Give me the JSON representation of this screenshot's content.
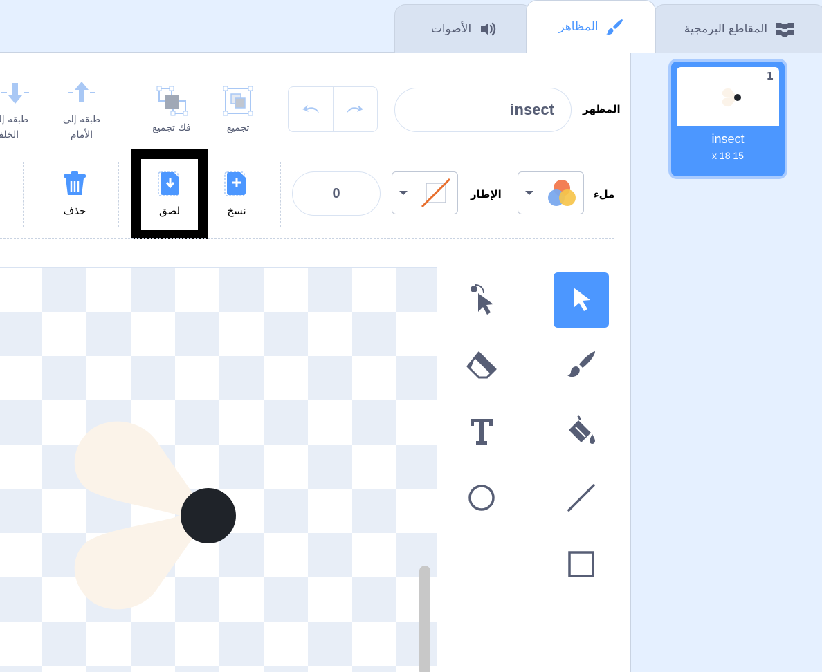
{
  "tabs": [
    {
      "label": "المقاطع البرمجية",
      "icon": "code-blocks-icon"
    },
    {
      "label": "المظاهر",
      "icon": "paint-brush-icon",
      "active": true
    },
    {
      "label": "الأصوات",
      "icon": "speaker-icon"
    }
  ],
  "toolbar": {
    "costume_label": "المظهر",
    "costume_name": "insect",
    "group_label": "تجميع",
    "ungroup_label": "فك تجميع",
    "forward_label_1": "طبقة إلى",
    "forward_label_2": "الأمام",
    "backward_label_1": "طبقة إلى",
    "backward_label_2": "الخلف",
    "fill_label": "ملء",
    "outline_label": "الإطار",
    "outline_width": "0",
    "copy_label": "نسخ",
    "paste_label": "لصق",
    "delete_label": "حذف"
  },
  "tools": [
    {
      "name": "select",
      "active": true
    },
    {
      "name": "reshape"
    },
    {
      "name": "brush"
    },
    {
      "name": "eraser"
    },
    {
      "name": "fill"
    },
    {
      "name": "text"
    },
    {
      "name": "line"
    },
    {
      "name": "circle"
    },
    {
      "name": "rectangle"
    }
  ],
  "costume": {
    "number": "1",
    "name": "insect",
    "size": "x 18 15"
  },
  "colors": {
    "accent": "#4c97ff",
    "text": "#575e75",
    "outline_slash": "#e86f2e",
    "insect_body": "#1f2329",
    "insect_wing": "#fbf3e9"
  }
}
